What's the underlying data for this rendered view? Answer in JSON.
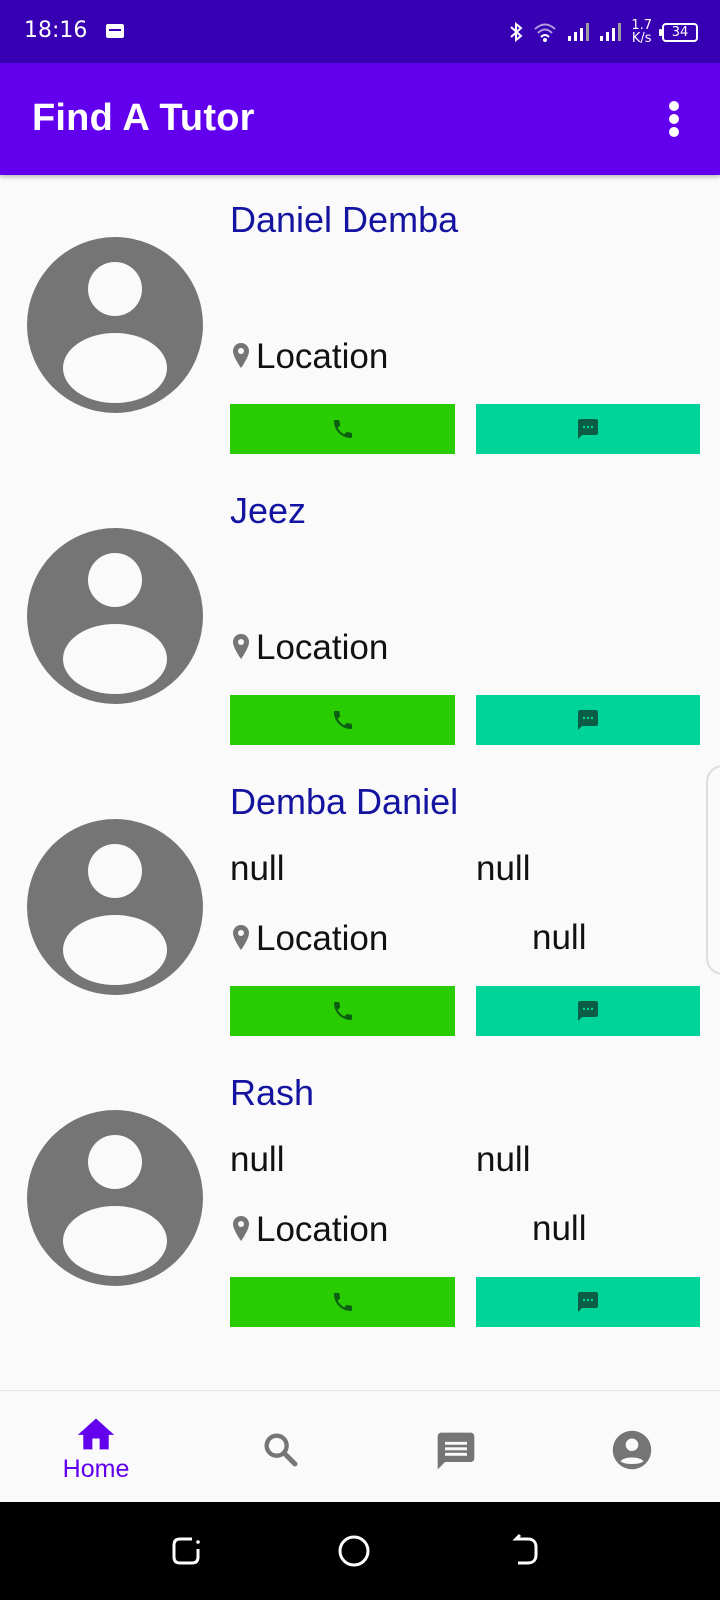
{
  "status_bar": {
    "time": "18:16",
    "speed_value": "1.7",
    "speed_unit": "K/s",
    "battery": "34"
  },
  "app_bar": {
    "title": "Find A Tutor",
    "overflow_icon": "more-vert-icon"
  },
  "tutors": [
    {
      "name": "Daniel Demba",
      "location": "Location",
      "subject": "",
      "level": "",
      "rate": ""
    },
    {
      "name": "Jeez",
      "location": "Location",
      "subject": "",
      "level": "",
      "rate": ""
    },
    {
      "name": "Demba Daniel",
      "location": "Location",
      "subject": "null",
      "level": "null",
      "rate": "null"
    },
    {
      "name": "Rash",
      "location": "Location",
      "subject": "null",
      "level": "null",
      "rate": "null"
    }
  ],
  "actions": {
    "call_icon": "phone-icon",
    "message_icon": "sms-icon",
    "call_color": "#28cc00",
    "message_color": "#00d498"
  },
  "bottom_nav": {
    "items": [
      {
        "label": "Home",
        "icon": "home-icon",
        "active": true
      },
      {
        "label": "",
        "icon": "search-icon",
        "active": false
      },
      {
        "label": "",
        "icon": "chat-icon",
        "active": false
      },
      {
        "label": "",
        "icon": "account-icon",
        "active": false
      }
    ],
    "active_color": "#6200ee"
  },
  "colors": {
    "status_bar": "#3700b3",
    "app_bar": "#6200ee",
    "tutor_name": "#1414a0"
  }
}
